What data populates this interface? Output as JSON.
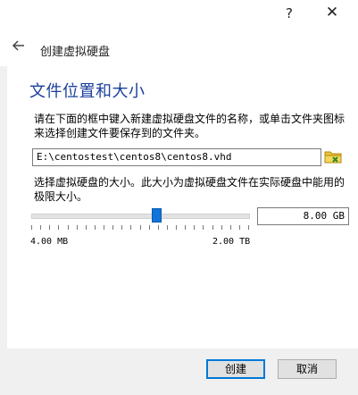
{
  "titlebar": {
    "help_label": "?",
    "close_label": "✕"
  },
  "header": {
    "back_icon": "arrow-left-icon",
    "title": "创建虚拟硬盘"
  },
  "section": {
    "title": "文件位置和大小"
  },
  "location": {
    "description": "请在下面的框中键入新建虚拟硬盘文件的名称，或单击文件夹图标来选择创建文件要保存到的文件夹。",
    "path_value": "E:\\centostest\\centos8\\centos8.vhd",
    "folder_icon": "folder-browse-icon"
  },
  "size": {
    "description": "选择虚拟硬盘的大小。此大小为虚拟硬盘文件在实际硬盘中能用的极限大小。",
    "value": "8.00 GB",
    "min_label": "4.00 MB",
    "max_label": "2.00 TB",
    "slider_fraction": 0.58
  },
  "footer": {
    "create_label": "创建",
    "cancel_label": "取消"
  },
  "colors": {
    "accent": "#0078d7",
    "title_blue": "#1a3f9a",
    "slider_blue": "#1273d8"
  }
}
